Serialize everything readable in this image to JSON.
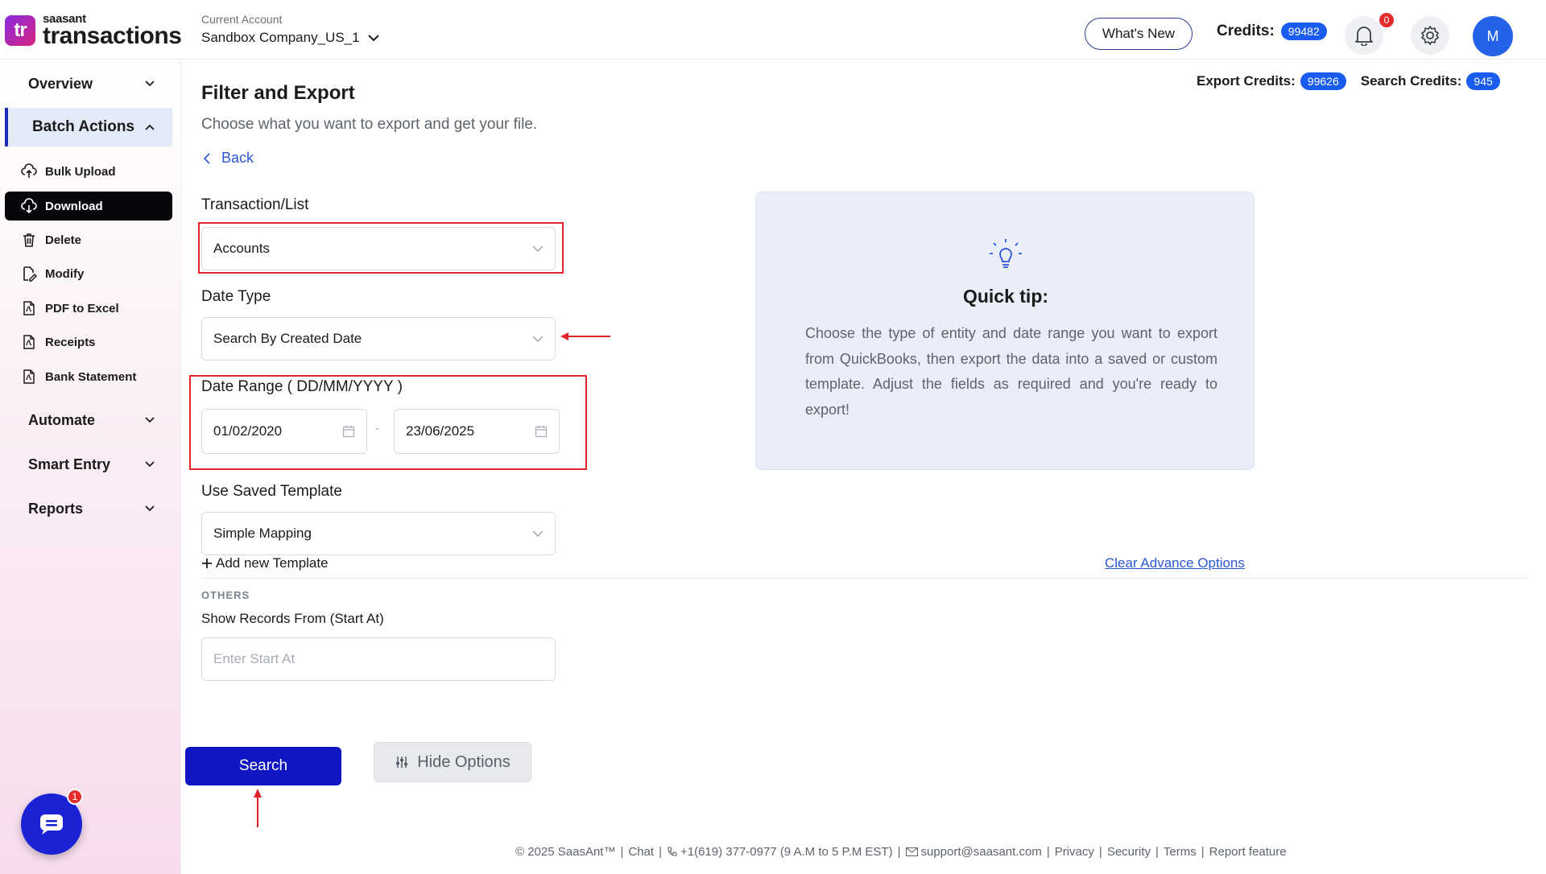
{
  "header": {
    "logo_top": "saasant",
    "logo_bottom": "transactions",
    "logo_mark": "tr",
    "account_label": "Current Account",
    "account_name": "Sandbox Company_US_1",
    "whats_new": "What's New",
    "credits_label": "Credits:",
    "credits_value": "99482",
    "notifications_count": "0",
    "avatar_initial": "M"
  },
  "sidebar": {
    "groups": {
      "overview": "Overview",
      "batch_actions": "Batch Actions",
      "automate": "Automate",
      "smart_entry": "Smart Entry",
      "reports": "Reports"
    },
    "items": [
      {
        "label": "Bulk Upload",
        "icon": "cloud-upload-icon"
      },
      {
        "label": "Download",
        "icon": "cloud-download-icon",
        "active": true
      },
      {
        "label": "Delete",
        "icon": "trash-icon"
      },
      {
        "label": "Modify",
        "icon": "edit-file-icon"
      },
      {
        "label": "PDF to Excel",
        "icon": "pdf-file-icon"
      },
      {
        "label": "Receipts",
        "icon": "pdf-file-icon"
      },
      {
        "label": "Bank Statement",
        "icon": "pdf-file-icon"
      }
    ],
    "chat_badge": "1"
  },
  "main": {
    "title": "Filter and Export",
    "subtitle": "Choose what you want to export and get your file.",
    "back": "Back",
    "export_credits_label": "Export Credits:",
    "export_credits_value": "99626",
    "search_credits_label": "Search Credits:",
    "search_credits_value": "945",
    "transaction_label": "Transaction/List",
    "transaction_value": "Accounts",
    "date_type_label": "Date Type",
    "date_type_value": "Search By Created Date",
    "date_range_label": "Date Range ( DD/MM/YYYY )",
    "date_from": "01/02/2020",
    "date_to": "23/06/2025",
    "date_sep": "-",
    "template_label": "Use Saved Template",
    "template_value": "Simple Mapping",
    "add_template": "Add new Template",
    "clear_options": "Clear Advance Options",
    "others_heading": "OTHERS",
    "start_at_label": "Show Records From (Start At)",
    "start_at_placeholder": "Enter Start At",
    "start_at_value": "",
    "search_button": "Search",
    "hide_options_button": "Hide Options"
  },
  "tip": {
    "title": "Quick tip:",
    "body": "Choose the type of entity and date range you want to export from QuickBooks, then export the data into a saved or custom template. Adjust the fields as required and you're ready to export!"
  },
  "footer": {
    "copyright": "© 2025 SaasAnt™",
    "chat": "Chat",
    "phone": "+1(619) 377-0977 (9 A.M to 5 P.M EST)",
    "email": "support@saasant.com",
    "privacy": "Privacy",
    "security": "Security",
    "terms": "Terms",
    "report": "Report feature"
  },
  "colors": {
    "accent": "#1016c4",
    "link": "#2a56d8",
    "highlight_box": "#e3232b",
    "credit_pill": "#1a5cf0"
  }
}
